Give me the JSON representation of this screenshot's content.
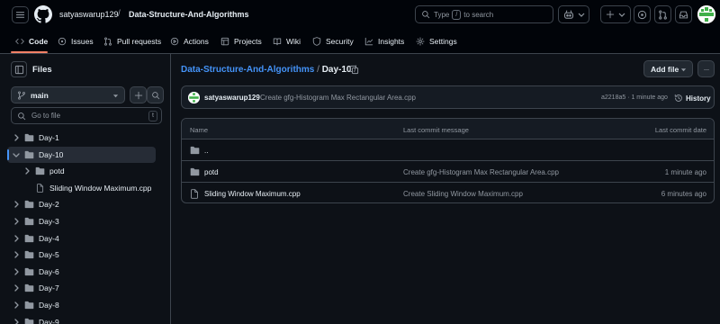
{
  "header": {
    "owner": "satyaswarup129",
    "separator": "/",
    "repo": "Data-Structure-And-Algorithms",
    "search_prefix": "Type",
    "search_key": "/",
    "search_suffix": "to search"
  },
  "repo_nav": {
    "tabs": [
      {
        "label": "Code",
        "icon": "code-icon"
      },
      {
        "label": "Issues",
        "icon": "issue-icon"
      },
      {
        "label": "Pull requests",
        "icon": "pull-request-icon"
      },
      {
        "label": "Actions",
        "icon": "play-icon"
      },
      {
        "label": "Projects",
        "icon": "table-icon"
      },
      {
        "label": "Wiki",
        "icon": "book-icon"
      },
      {
        "label": "Security",
        "icon": "shield-icon"
      },
      {
        "label": "Insights",
        "icon": "graph-icon"
      },
      {
        "label": "Settings",
        "icon": "gear-icon"
      }
    ]
  },
  "sidebar": {
    "title": "Files",
    "branch": "main",
    "goto_placeholder": "Go to file",
    "goto_key": "t",
    "tree": [
      {
        "label": "Day-1",
        "type": "folder",
        "expanded": false,
        "depth": 0
      },
      {
        "label": "Day-10",
        "type": "folder",
        "expanded": true,
        "depth": 0,
        "active": true
      },
      {
        "label": "potd",
        "type": "folder",
        "expanded": false,
        "depth": 1
      },
      {
        "label": "Sliding Window Maximum.cpp",
        "type": "file",
        "depth": 1
      },
      {
        "label": "Day-2",
        "type": "folder",
        "expanded": false,
        "depth": 0
      },
      {
        "label": "Day-3",
        "type": "folder",
        "expanded": false,
        "depth": 0
      },
      {
        "label": "Day-4",
        "type": "folder",
        "expanded": false,
        "depth": 0
      },
      {
        "label": "Day-5",
        "type": "folder",
        "expanded": false,
        "depth": 0
      },
      {
        "label": "Day-6",
        "type": "folder",
        "expanded": false,
        "depth": 0
      },
      {
        "label": "Day-7",
        "type": "folder",
        "expanded": false,
        "depth": 0
      },
      {
        "label": "Day-8",
        "type": "folder",
        "expanded": false,
        "depth": 0
      },
      {
        "label": "Day-9",
        "type": "folder",
        "expanded": false,
        "depth": 0
      }
    ]
  },
  "main": {
    "breadcrumb_repo": "Data-Structure-And-Algorithms",
    "breadcrumb_sep": "/",
    "breadcrumb_current": "Day-10",
    "add_file_label": "Add file",
    "more_label": "···",
    "commit": {
      "author": "satyaswarup129",
      "message": "Create gfg-Histogram Max Rectangular Area.cpp",
      "meta": "a2218a5 · 1 minute ago",
      "history_label": "History"
    },
    "table": {
      "col_name": "Name",
      "col_message": "Last commit message",
      "col_date": "Last commit date",
      "parent_dir": "..",
      "rows": [
        {
          "name": "potd",
          "type": "folder",
          "message": "Create gfg-Histogram Max Rectangular Area.cpp",
          "date": "1 minute ago"
        },
        {
          "name": "Sliding Window Maximum.cpp",
          "type": "file",
          "message": "Create Sliding Window Maximum.cpp",
          "date": "6 minutes ago"
        }
      ]
    }
  },
  "colors": {
    "background": "#0d1117",
    "header_bg": "#010409",
    "link": "#4493f8",
    "active_tab": "#f78166",
    "border": "#3d444d"
  }
}
